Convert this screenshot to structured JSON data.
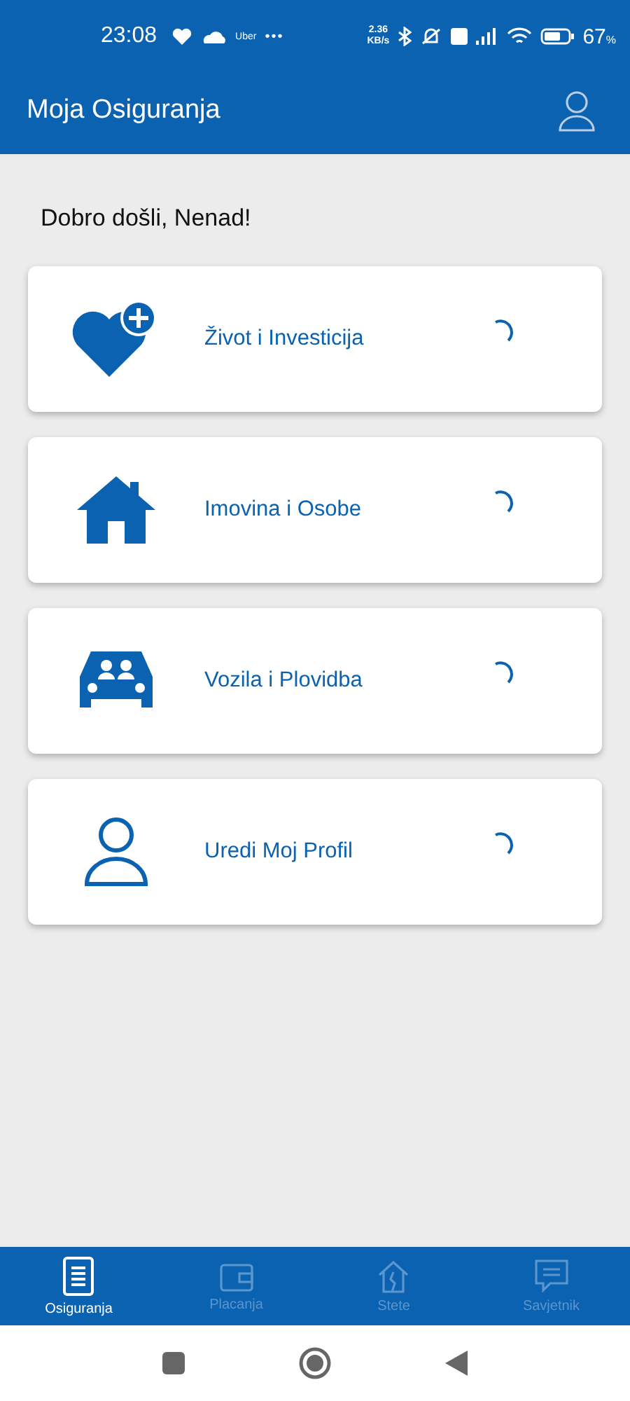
{
  "status_bar": {
    "time": "23:08",
    "app_label": "Uber",
    "more": "•••",
    "speed": "2.36",
    "speed_unit": "KB/s",
    "battery": "67",
    "battery_unit": "%"
  },
  "app_bar": {
    "title": "Moja Osiguranja"
  },
  "greeting": "Dobro došli, Nenad!",
  "cards": [
    {
      "kind": "heart",
      "label": "Život i Investicija",
      "loading": true
    },
    {
      "kind": "house",
      "label": "Imovina i Osobe",
      "loading": true
    },
    {
      "kind": "car",
      "label": "Vozila i Plovidba",
      "loading": true
    },
    {
      "kind": "person",
      "label": "Uredi Moj Profil",
      "loading": true
    }
  ],
  "bottom_nav": [
    {
      "kind": "document",
      "label": "Osiguranja",
      "selected": true
    },
    {
      "kind": "wallet",
      "label": "Placanja",
      "selected": false
    },
    {
      "kind": "house",
      "label": "Stete",
      "selected": false
    },
    {
      "kind": "chat",
      "label": "Savjetnik",
      "selected": false
    }
  ]
}
